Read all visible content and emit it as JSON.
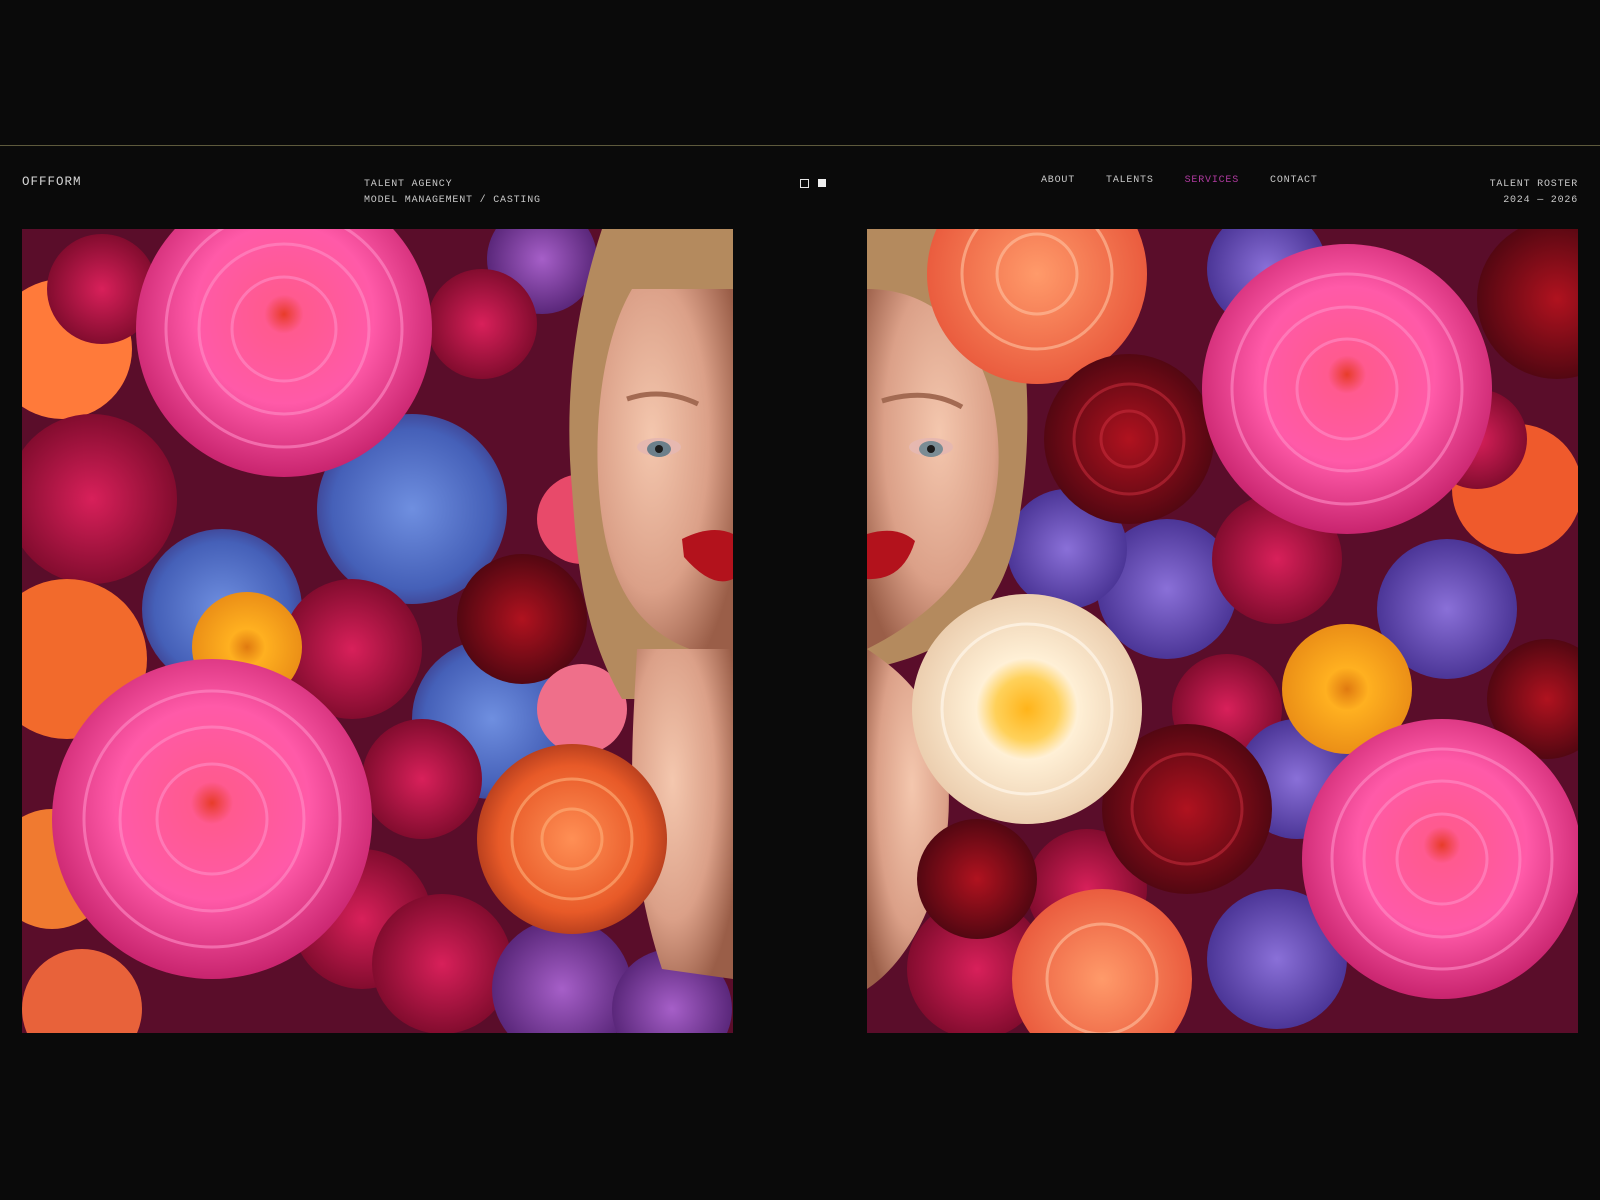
{
  "header": {
    "logo": "OFFFORM",
    "tagline": {
      "line1": "TALENT AGENCY",
      "line2": "MODEL MANAGEMENT / CASTING"
    },
    "nav": [
      {
        "label": "ABOUT",
        "active": false
      },
      {
        "label": "TALENTS",
        "active": false
      },
      {
        "label": "SERVICES",
        "active": true
      },
      {
        "label": "CONTACT",
        "active": false
      }
    ],
    "roster": {
      "line1": "TALENT ROSTER",
      "line2": "2024 — 2026"
    }
  },
  "colors": {
    "background": "#0a0a0a",
    "text": "#c9c9c9",
    "nav_active": "#b03aa0",
    "rule": "#5e5a3d"
  },
  "gallery": {
    "images": [
      {
        "subject": "woman's face surrounded by pink, red, orange and blue flowers, face on right edge"
      },
      {
        "subject": "woman's face surrounded by pink, red, cream and purple flowers, face on left edge"
      }
    ]
  }
}
